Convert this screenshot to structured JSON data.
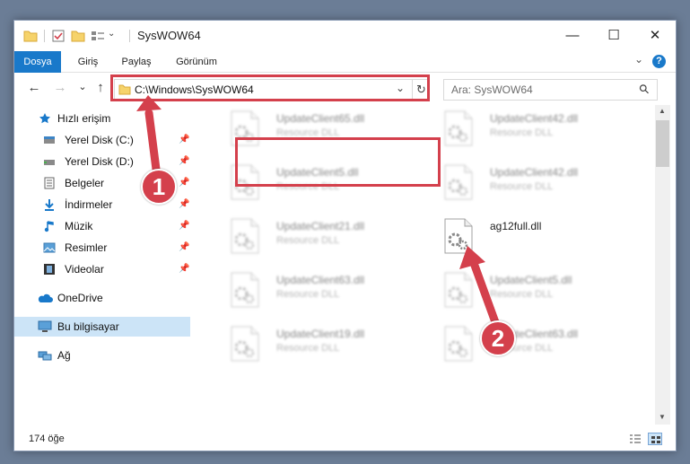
{
  "window": {
    "title": "SysWOW64",
    "minimize": "—",
    "maximize": "☐",
    "close": "✕"
  },
  "ribbon": {
    "tabs": [
      "Dosya",
      "Giriş",
      "Paylaş",
      "Görünüm"
    ],
    "collapse": "⌄",
    "help": "?"
  },
  "nav": {
    "back": "←",
    "forward": "→",
    "recent": "⌄",
    "up": "↑"
  },
  "address": {
    "path": "C:\\Windows\\SysWOW64",
    "dropdown": "⌄",
    "refresh": "↻"
  },
  "search": {
    "placeholder": "Ara: SysWOW64",
    "icon": "⚲"
  },
  "sidebar": {
    "quick_access": "Hızlı erişim",
    "items": [
      {
        "label": "Yerel Disk (C:)",
        "icon": "drive-icon"
      },
      {
        "label": "Yerel Disk (D:)",
        "icon": "drive-icon"
      },
      {
        "label": "Belgeler",
        "icon": "document-icon"
      },
      {
        "label": "İndirmeler",
        "icon": "download-icon"
      },
      {
        "label": "Müzik",
        "icon": "music-icon"
      },
      {
        "label": "Resimler",
        "icon": "pictures-icon"
      },
      {
        "label": "Videolar",
        "icon": "video-icon"
      }
    ],
    "pin": "📌",
    "onedrive": "OneDrive",
    "this_pc": "Bu bilgisayar",
    "network": "Ağ"
  },
  "files": [
    {
      "name": "UpdateClient65.dll",
      "type": "Resource DLL",
      "col": 0,
      "row": 0
    },
    {
      "name": "UpdateClient42.dll",
      "type": "Resource DLL",
      "col": 1,
      "row": 0
    },
    {
      "name": "UpdateClient5.dll",
      "type": "Resource DLL",
      "col": 0,
      "row": 1
    },
    {
      "name": "UpdateClient42.dll",
      "type": "Resource DLL",
      "col": 1,
      "row": 1
    },
    {
      "name": "UpdateClient21.dll",
      "type": "Resource DLL",
      "col": 0,
      "row": 2
    },
    {
      "name": "ag12full.dll",
      "type": "",
      "col": 1,
      "row": 2,
      "highlighted": true
    },
    {
      "name": "UpdateClient63.dll",
      "type": "Resource DLL",
      "col": 0,
      "row": 3
    },
    {
      "name": "UpdateClient5.dll",
      "type": "Resource DLL",
      "col": 1,
      "row": 3
    },
    {
      "name": "UpdateClient19.dll",
      "type": "Resource DLL",
      "col": 0,
      "row": 4
    },
    {
      "name": "UpdateClient63.dll",
      "type": "Resource DLL",
      "col": 1,
      "row": 4
    }
  ],
  "status": {
    "count": "174 öğe"
  },
  "callouts": [
    "1",
    "2"
  ],
  "colors": {
    "accent": "#1979ca",
    "highlight": "#d4404c",
    "selection": "#cce4f7"
  }
}
